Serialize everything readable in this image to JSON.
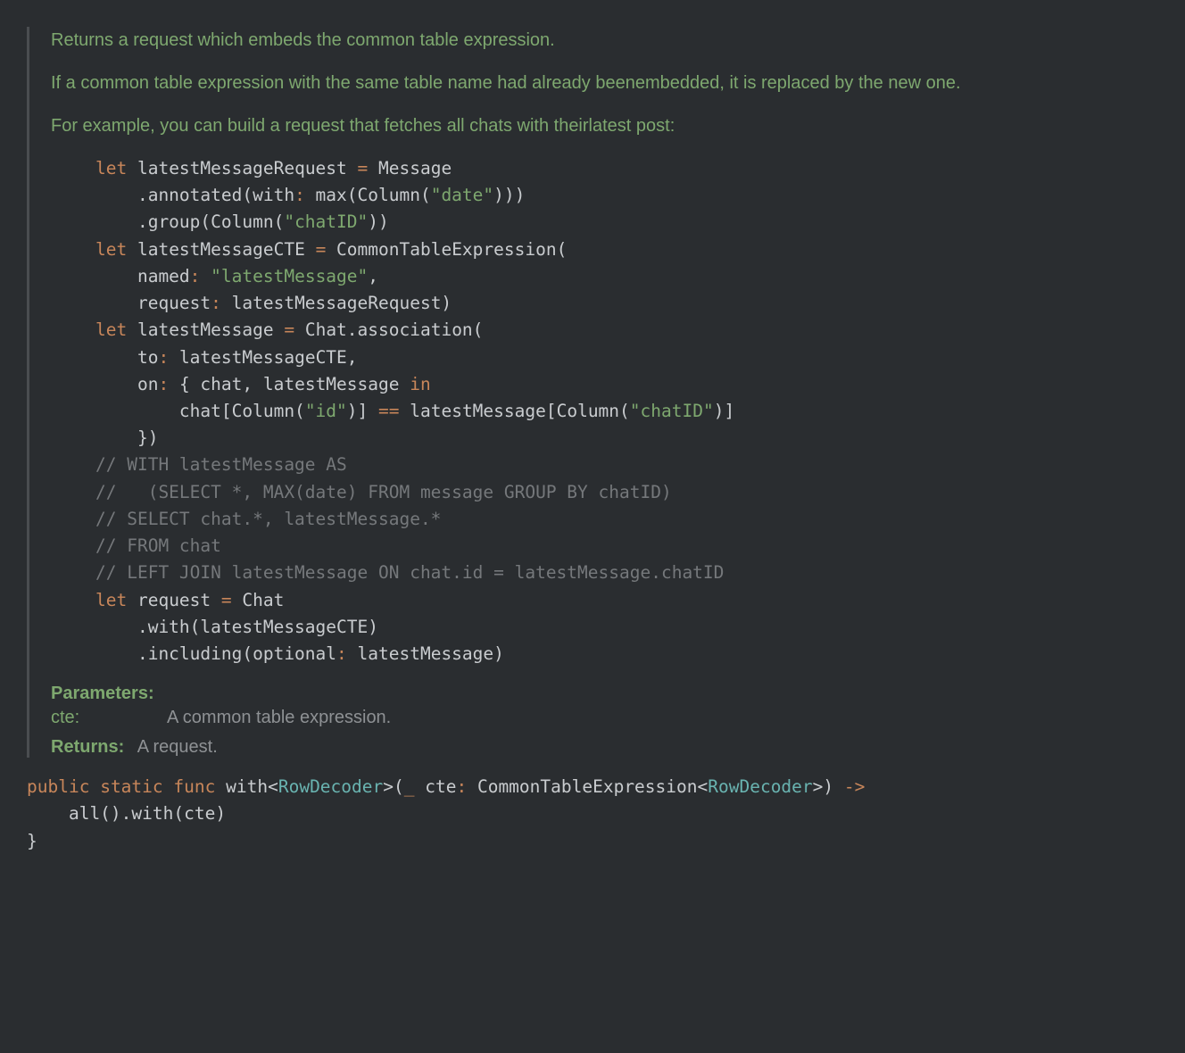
{
  "doc": {
    "para1": "Returns a request which embeds the common table expression.",
    "para2": "If a common table expression with the same table name had already beenembedded, it is replaced by the new one.",
    "para3": "For example, you can build a request that fetches all chats with theirlatest post:"
  },
  "code": {
    "l01_kw": "let",
    "l01_a": " latestMessageRequest ",
    "l01_eq": "=",
    "l01_b": " Message",
    "l02_a": "    .annotated(with",
    "l02_c": ":",
    "l02_b": " max(Column(",
    "l02_s": "\"date\"",
    "l02_d": ")))",
    "l03_a": "    .group(Column(",
    "l03_s": "\"chatID\"",
    "l03_b": "))",
    "l04_kw": "let",
    "l04_a": " latestMessageCTE ",
    "l04_eq": "=",
    "l04_b": " CommonTableExpression(",
    "l05_a": "    named",
    "l05_c": ":",
    "l05_sp": " ",
    "l05_s": "\"latestMessage\"",
    "l05_b": ",",
    "l06_a": "    request",
    "l06_c": ":",
    "l06_b": " latestMessageRequest)",
    "l07_kw": "let",
    "l07_a": " latestMessage ",
    "l07_eq": "=",
    "l07_b": " Chat.association(",
    "l08_a": "    to",
    "l08_c": ":",
    "l08_b": " latestMessageCTE,",
    "l09_a": "    on",
    "l09_c": ":",
    "l09_b": " { chat, latestMessage ",
    "l09_kw": "in",
    "l10_a": "        chat[Column(",
    "l10_s1": "\"id\"",
    "l10_b": ")] ",
    "l10_eq": "==",
    "l10_c": " latestMessage[Column(",
    "l10_s2": "\"chatID\"",
    "l10_d": ")]",
    "l11_a": "    })",
    "l12": "// WITH latestMessage AS",
    "l13": "//   (SELECT *, MAX(date) FROM message GROUP BY chatID)",
    "l14": "// SELECT chat.*, latestMessage.*",
    "l15": "// FROM chat",
    "l16": "// LEFT JOIN latestMessage ON chat.id = latestMessage.chatID",
    "l17_kw": "let",
    "l17_a": " request ",
    "l17_eq": "=",
    "l17_b": " Chat",
    "l18_a": "    .with(latestMessageCTE)",
    "l19_a": "    .including(optional",
    "l19_c": ":",
    "l19_b": " latestMessage)"
  },
  "params": {
    "label": "Parameters:",
    "name": "cte:",
    "desc": "A common table expression."
  },
  "returns": {
    "label": "Returns:",
    "desc": "A request."
  },
  "sig": {
    "s1_kw1": "public",
    "s1_sp1": " ",
    "s1_kw2": "static",
    "s1_sp2": " ",
    "s1_kw3": "func",
    "s1_sp3": " ",
    "s1_name": "with",
    "s1_lt": "<",
    "s1_t1": "RowDecoder",
    "s1_gt": ">",
    "s1_a": "(",
    "s1_us": "_",
    "s1_b": " cte",
    "s1_c": ":",
    "s1_d": " CommonTableExpression",
    "s1_lt2": "<",
    "s1_t2": "RowDecoder",
    "s1_gt2": ">",
    "s1_e": ") ",
    "s1_arrow": "->",
    "s2": "    all().with(cte)",
    "s3": "}"
  }
}
